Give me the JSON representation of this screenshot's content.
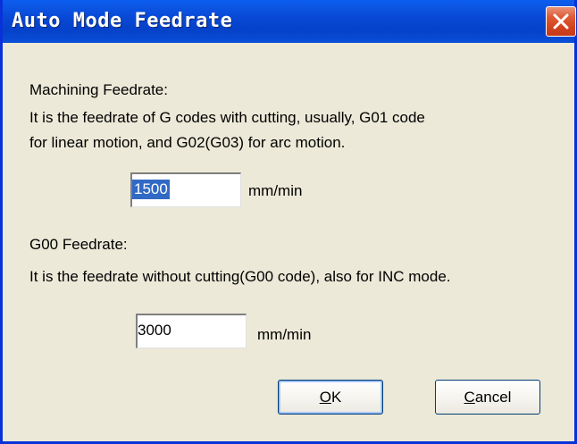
{
  "window": {
    "title": "Auto Mode Feedrate"
  },
  "machining": {
    "heading": "Machining Feedrate:",
    "line1": "It is the feedrate of G codes with cutting, usually, G01 code",
    "line2": "for linear motion, and G02(G03) for arc motion.",
    "value": "1500",
    "unit": "mm/min"
  },
  "g00": {
    "heading": "G00 Feedrate:",
    "line1": "It is the feedrate without cutting(G00 code), also for INC mode.",
    "value": "3000",
    "unit": "mm/min"
  },
  "buttons": {
    "ok_first": "O",
    "ok_rest": "K",
    "cancel_first": "C",
    "cancel_rest": "ancel"
  },
  "icons": {
    "close": "close-icon"
  },
  "colors": {
    "titlebar": "#0849d6",
    "close": "#d2441f",
    "selection": "#316ac5",
    "face": "#ece9d8"
  }
}
